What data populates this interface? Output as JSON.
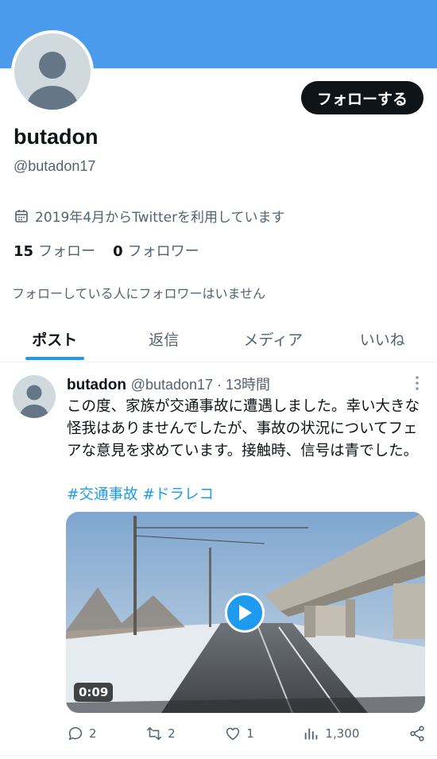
{
  "profile": {
    "follow_label": "フォローする",
    "name": "butadon",
    "handle": "@butadon17",
    "joined": "2019年4月からTwitterを利用しています",
    "following_count": "15",
    "following_label": "フォロー",
    "followers_count": "0",
    "followers_label": "フォロワー",
    "notice": "フォローしている人にフォロワーはいません"
  },
  "tabs": [
    {
      "label": "ポスト",
      "active": true
    },
    {
      "label": "返信"
    },
    {
      "label": "メディア"
    },
    {
      "label": "いいね"
    }
  ],
  "post": {
    "name": "butadon",
    "meta": "@butadon17 · 13時間",
    "text": "この度、家族が交通事故に遭遇しました。幸い大きな怪我はありませんでしたが、事故の状況についてフェアな意見を求めています。接触時、信号は青でした。",
    "tags": [
      "#交通事故",
      "#ドラレコ"
    ],
    "video_duration": "0:09",
    "replies": "2",
    "reposts": "2",
    "likes": "1",
    "views": "1,300"
  },
  "colors": {
    "banner": "#4a9bec",
    "accent": "#1d9bf0",
    "text": "#0f1419",
    "muted": "#536471"
  },
  "icons": [
    "calendar-icon",
    "reply-icon",
    "repost-icon",
    "like-icon",
    "views-icon",
    "share-icon",
    "more-icon",
    "play-icon"
  ]
}
